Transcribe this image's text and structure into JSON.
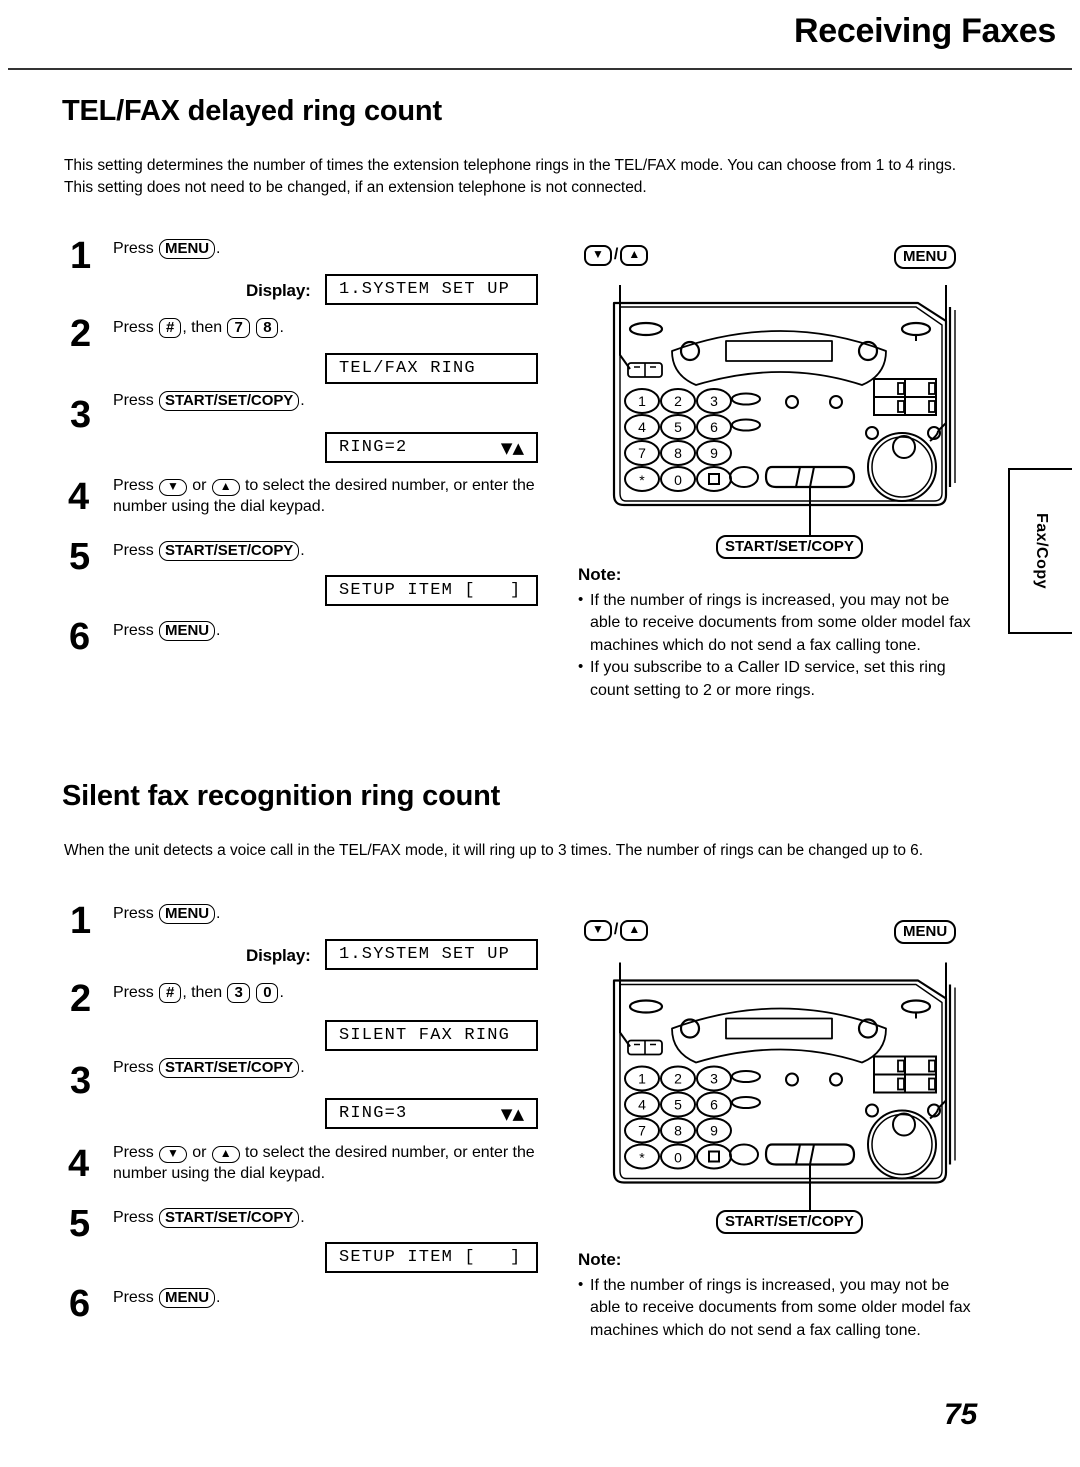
{
  "header": {
    "title": "Receiving Faxes"
  },
  "page_number": "75",
  "side_tab": {
    "label": "Fax/Copy"
  },
  "sections": [
    {
      "id": "tel-fax-delayed-ring-count",
      "title": "TEL/FAX delayed ring count",
      "intro": "This setting determines the number of times the extension telephone rings in the TEL/FAX mode. You can choose from 1 to 4 rings.\nThis setting does not need to be changed, if an extension telephone is not connected.",
      "display_label": "Display:",
      "steps": [
        {
          "num": "1",
          "prefix": "Press ",
          "key": "MENU",
          "suffix": "."
        },
        {
          "num": "2",
          "prefix": "Press ",
          "key": "#",
          "mid": ", then ",
          "key2": "7",
          "key3": "8",
          "suffix": "."
        },
        {
          "num": "3",
          "prefix": "Press ",
          "key": "START/SET/COPY",
          "suffix": "."
        },
        {
          "num": "4",
          "prefix": "Press ",
          "key": "▼",
          "mid": " or ",
          "key2": "▲",
          "suffix": " to select the desired number, or enter the number using the dial keypad."
        },
        {
          "num": "5",
          "prefix": "Press ",
          "key": "START/SET/COPY",
          "suffix": "."
        },
        {
          "num": "6",
          "prefix": "Press ",
          "key": "MENU",
          "suffix": "."
        }
      ],
      "lcds": [
        {
          "text": "1.SYSTEM SET UP",
          "arrows": ""
        },
        {
          "text": "TEL/FAX RING",
          "arrows": ""
        },
        {
          "text": "RING=2",
          "arrows": "▼▲"
        },
        {
          "text": "SETUP ITEM [   ]",
          "arrows": ""
        }
      ],
      "note": {
        "title": "Note:",
        "items": [
          "If the number of rings is increased, you may not be able to receive documents from some older model fax machines which do not send a fax calling tone.",
          "If you subscribe to a Caller ID service, set this ring count setting to 2 or more rings."
        ]
      },
      "figure": {
        "callout_updown_down": "▼",
        "callout_updown_sep": "/",
        "callout_updown_up": "▲",
        "callout_menu": "MENU",
        "callout_start": "START/SET/COPY",
        "keypad": [
          "1",
          "2",
          "3",
          "4",
          "5",
          "6",
          "7",
          "8",
          "9",
          "∗",
          "0",
          "■"
        ]
      }
    },
    {
      "id": "silent-fax-recognition-ring-count",
      "title": "Silent fax recognition ring count",
      "intro": "When the unit detects a voice call in the TEL/FAX mode, it will ring up to 3 times. The number of rings can be changed up to 6.",
      "display_label": "Display:",
      "steps": [
        {
          "num": "1",
          "prefix": "Press ",
          "key": "MENU",
          "suffix": "."
        },
        {
          "num": "2",
          "prefix": "Press ",
          "key": "#",
          "mid": ", then ",
          "key2": "3",
          "key3": "0",
          "suffix": "."
        },
        {
          "num": "3",
          "prefix": "Press ",
          "key": "START/SET/COPY",
          "suffix": "."
        },
        {
          "num": "4",
          "prefix": "Press ",
          "key": "▼",
          "mid": " or ",
          "key2": "▲",
          "suffix": " to select the desired number, or enter the number using the dial keypad."
        },
        {
          "num": "5",
          "prefix": "Press ",
          "key": "START/SET/COPY",
          "suffix": "."
        },
        {
          "num": "6",
          "prefix": "Press ",
          "key": "MENU",
          "suffix": "."
        }
      ],
      "lcds": [
        {
          "text": "1.SYSTEM SET UP",
          "arrows": ""
        },
        {
          "text": "SILENT FAX RING",
          "arrows": ""
        },
        {
          "text": "RING=3",
          "arrows": "▼▲"
        },
        {
          "text": "SETUP ITEM [   ]",
          "arrows": ""
        }
      ],
      "note": {
        "title": "Note:",
        "items": [
          "If the number of rings is increased, you may not be able to receive documents from some older model fax machines which do not send a fax calling tone."
        ]
      },
      "figure": {
        "callout_updown_down": "▼",
        "callout_updown_sep": "/",
        "callout_updown_up": "▲",
        "callout_menu": "MENU",
        "callout_start": "START/SET/COPY",
        "keypad": [
          "1",
          "2",
          "3",
          "4",
          "5",
          "6",
          "7",
          "8",
          "9",
          "∗",
          "0",
          "■"
        ]
      }
    }
  ]
}
